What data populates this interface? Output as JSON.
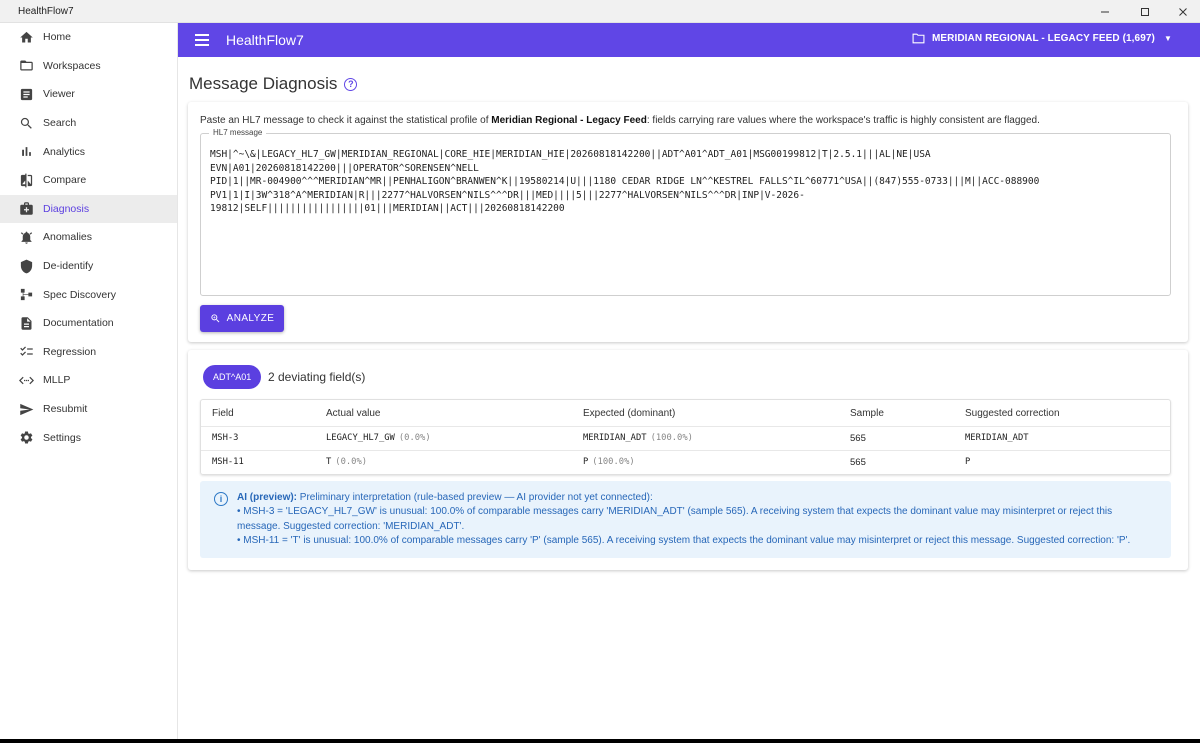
{
  "window": {
    "title": "HealthFlow7",
    "minimize": "—",
    "maximize": "☐",
    "close": "✕"
  },
  "sidebar": {
    "items": [
      {
        "label": "Home",
        "icon": "home-icon"
      },
      {
        "label": "Workspaces",
        "icon": "folder-icon"
      },
      {
        "label": "Viewer",
        "icon": "document-icon"
      },
      {
        "label": "Search",
        "icon": "search-icon"
      },
      {
        "label": "Analytics",
        "icon": "bar-chart-icon"
      },
      {
        "label": "Compare",
        "icon": "compare-icon"
      },
      {
        "label": "Diagnosis",
        "icon": "medical-bag-icon",
        "active": true
      },
      {
        "label": "Anomalies",
        "icon": "alarm-icon"
      },
      {
        "label": "De-identify",
        "icon": "shield-icon"
      },
      {
        "label": "Spec Discovery",
        "icon": "tree-icon"
      },
      {
        "label": "Documentation",
        "icon": "file-icon"
      },
      {
        "label": "Regression",
        "icon": "checklist-icon"
      },
      {
        "label": "MLLP",
        "icon": "connection-icon"
      },
      {
        "label": "Resubmit",
        "icon": "send-icon"
      },
      {
        "label": "Settings",
        "icon": "gear-icon"
      }
    ]
  },
  "appbar": {
    "title": "HealthFlow7",
    "workspace": "MERIDIAN REGIONAL - LEGACY FEED (1,697)"
  },
  "page": {
    "title": "Message Diagnosis",
    "intro_before": "Paste an HL7 message to check it against the statistical profile of ",
    "intro_bold": "Meridian Regional - Legacy Feed",
    "intro_after": ": fields carrying rare values where the workspace's traffic is highly consistent are flagged.",
    "hl7_label": "HL7 message",
    "hl7_message": "MSH|^~\\&|LEGACY_HL7_GW|MERIDIAN_REGIONAL|CORE_HIE|MERIDIAN_HIE|20260818142200||ADT^A01^ADT_A01|MSG00199812|T|2.5.1|||AL|NE|USA\nEVN|A01|20260818142200|||OPERATOR^SORENSEN^NELL\nPID|1||MR-004900^^^MERIDIAN^MR||PENHALIGON^BRANWEN^K||19580214|U|||1180 CEDAR RIDGE LN^^KESTREL FALLS^IL^60771^USA||(847)555-0733|||M||ACC-088900\nPV1|1|I|3W^318^A^MERIDIAN|R|||2277^HALVORSEN^NILS^^^DR|||MED||||5|||2277^HALVORSEN^NILS^^^DR|INP|V-2026-\n19812|SELF|||||||||||||||||01|||MERIDIAN||ACT|||20260818142200",
    "analyze_label": "ANALYZE"
  },
  "results": {
    "chip": "ADT^A01",
    "summary": "2 deviating field(s)",
    "columns": [
      "Field",
      "Actual value",
      "Expected (dominant)",
      "Sample",
      "Suggested correction"
    ],
    "rows": [
      {
        "field": "MSH-3",
        "actual": "LEGACY_HL7_GW",
        "actual_pct": "(0.0%)",
        "expected": "MERIDIAN_ADT",
        "expected_pct": "(100.0%)",
        "sample": "565",
        "suggestion": "MERIDIAN_ADT"
      },
      {
        "field": "MSH-11",
        "actual": "T",
        "actual_pct": "(0.0%)",
        "expected": "P",
        "expected_pct": "(100.0%)",
        "sample": "565",
        "suggestion": "P"
      }
    ],
    "ai": {
      "label": "AI (preview):",
      "intro": " Preliminary interpretation (rule-based preview — AI provider not yet connected):",
      "line1": "• MSH-3 = 'LEGACY_HL7_GW' is unusual: 100.0% of comparable messages carry 'MERIDIAN_ADT' (sample 565). A receiving system that expects the dominant value may misinterpret or reject this message. Suggested correction: 'MERIDIAN_ADT'.",
      "line2": "• MSH-11 = 'T' is unusual: 100.0% of comparable messages carry 'P' (sample 565). A receiving system that expects the dominant value may misinterpret or reject this message. Suggested correction: 'P'."
    }
  },
  "colors": {
    "accent": "#6046e6",
    "button": "#5b3fe0",
    "info_bg": "#e9f3fc",
    "info_text": "#2767b8"
  }
}
